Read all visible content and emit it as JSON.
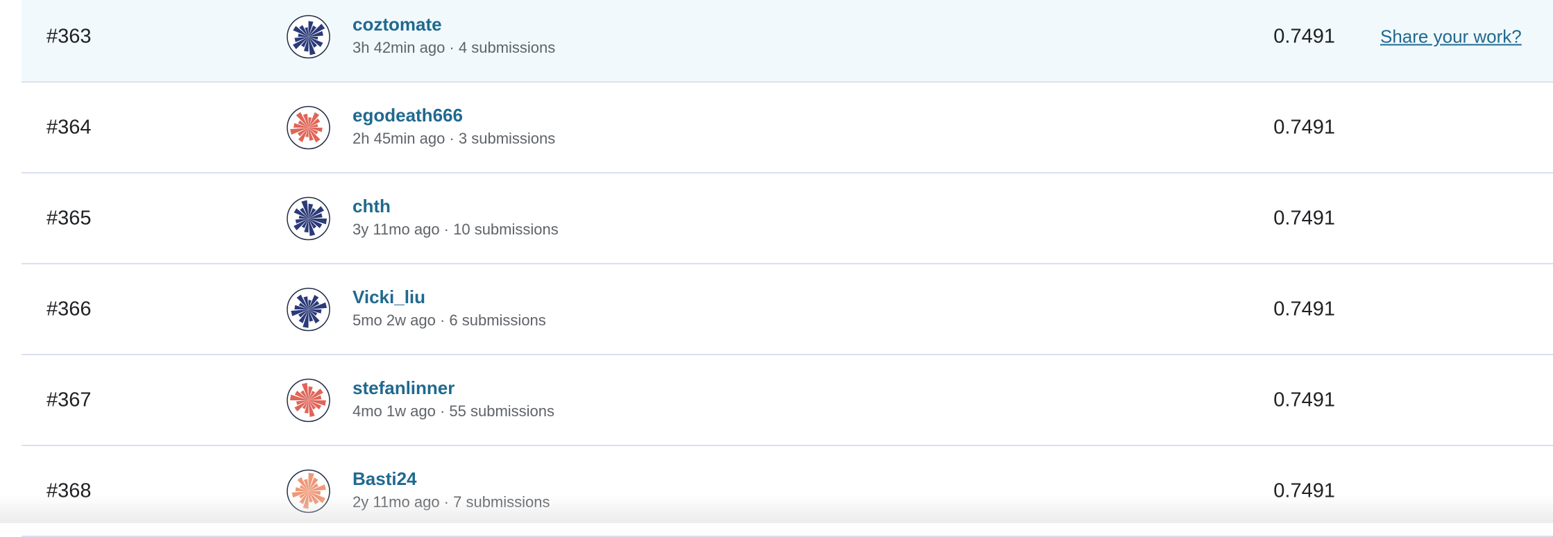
{
  "colors": {
    "navy": "#2b3a78",
    "red": "#e06558",
    "salmon": "#ee9878",
    "link": "#20698f",
    "highlight": "#f1f9fd"
  },
  "share_label": "Share your work?",
  "rows": [
    {
      "rank": "#363",
      "name": "coztomate",
      "meta": "3h 42min ago · 4 submissions",
      "score": "0.7491",
      "avatar_color": "navy",
      "highlight": true
    },
    {
      "rank": "#364",
      "name": "egodeath666",
      "meta": "2h 45min ago · 3 submissions",
      "score": "0.7491",
      "avatar_color": "red"
    },
    {
      "rank": "#365",
      "name": "chth",
      "meta": "3y 11mo ago · 10 submissions",
      "score": "0.7491",
      "avatar_color": "navy"
    },
    {
      "rank": "#366",
      "name": "Vicki_liu",
      "meta": "5mo 2w ago · 6 submissions",
      "score": "0.7491",
      "avatar_color": "navy"
    },
    {
      "rank": "#367",
      "name": "stefanlinner",
      "meta": "4mo 1w ago · 55 submissions",
      "score": "0.7491",
      "avatar_color": "red"
    },
    {
      "rank": "#368",
      "name": "Basti24",
      "meta": "2y 11mo ago · 7 submissions",
      "score": "0.7491",
      "avatar_color": "salmon"
    }
  ]
}
